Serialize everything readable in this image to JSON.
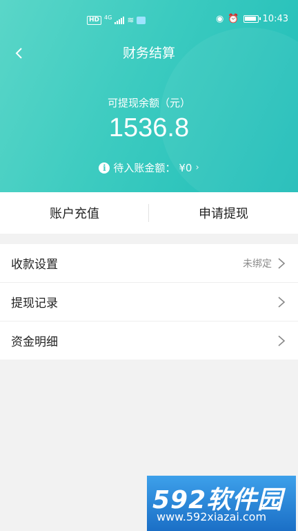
{
  "status_bar": {
    "hd": "HD",
    "network": "4G",
    "time": "10:43",
    "icons": [
      "signal-icon",
      "wifi-icon",
      "eye-icon",
      "alarm-icon",
      "battery-icon"
    ]
  },
  "header": {
    "title": "财务结算",
    "back_icon": "chevron-left-icon"
  },
  "balance": {
    "label": "可提现余额（元）",
    "amount": "1536.8",
    "pending_label": "待入账金额：",
    "pending_value": "¥0",
    "pending_chevron": "›"
  },
  "actions": {
    "recharge": "账户充值",
    "withdraw": "申请提现"
  },
  "menu": {
    "items": [
      {
        "label": "收款设置",
        "value": "未绑定"
      },
      {
        "label": "提现记录",
        "value": ""
      },
      {
        "label": "资金明细",
        "value": ""
      }
    ]
  },
  "watermark": {
    "logo": "592软件园",
    "url": "www.592xiazai.com"
  },
  "colors": {
    "header_start": "#5ad6c8",
    "header_end": "#1fbdb8",
    "background": "#f2f2f2"
  }
}
